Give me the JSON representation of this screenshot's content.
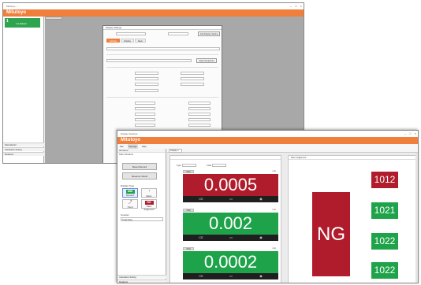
{
  "colors": {
    "accent": "#f07f3c",
    "ok": "#1fa34a",
    "ng": "#b01c2b"
  },
  "back_window": {
    "title": "Mitutoyo - ...",
    "brand": "Mitutoyo",
    "controls": [
      "–",
      "□",
      "×"
    ],
    "tile": {
      "number": "1",
      "label": "1,0,Master"
    },
    "footer_items": [
      "Data Monitor",
      "Calculation Setting",
      "Readouts"
    ],
    "dialog": {
      "title": "Display Settings",
      "button_top": "Add Display Setting",
      "button_mid": "Select Readouts",
      "tabs": [
        "Settings",
        "Display",
        "Save"
      ]
    }
  },
  "front_window": {
    "title": "Display Settings",
    "brand": "Mitutoyo",
    "controls": [
      "–",
      "□",
      "×"
    ],
    "menu": [
      "File",
      "Settings",
      "Help"
    ],
    "left": {
      "header": "All Items",
      "section": "Main Window",
      "buttons": [
        "Reset Record",
        "Measure Stand"
      ],
      "display_type_label": "Display Type",
      "display_types": [
        {
          "label": "Numeric",
          "glyph": "",
          "mini": "888"
        },
        {
          "label": "Meter",
          "glyph": "◔",
          "mini": ""
        },
        {
          "label": "Trend",
          "glyph": "⤴",
          "mini": ""
        },
        {
          "label": "Pass Judgement",
          "glyph": "",
          "mini": "NG"
        }
      ],
      "counter_label": "Counter",
      "counter_value": "Total Pass",
      "footer_items": [
        "Calculation Setting",
        "Readouts"
      ]
    },
    "content_tab": "Display 1",
    "panel_a": {
      "tool_type": "Type",
      "tool_code": "Code"
    },
    "gauges": [
      {
        "tag": "T001",
        "unit": "mm",
        "value": "0.0005",
        "state": "ng"
      },
      {
        "tag": "T002",
        "unit": "mm",
        "value": "0.002",
        "state": "ok"
      },
      {
        "tag": "T003",
        "unit": "mm",
        "value": "0.0002",
        "state": "ok"
      }
    ],
    "gauge_actions": [
      "CE",
      "▭",
      "◉"
    ],
    "panel_b": {
      "title": "Pass Judgement",
      "ng_label": "NG",
      "badges": [
        {
          "value": "1012",
          "state": "ng"
        },
        {
          "value": "1021",
          "state": "ok"
        },
        {
          "value": "1022",
          "state": "ok"
        },
        {
          "value": "1022",
          "state": "ok"
        }
      ]
    }
  }
}
